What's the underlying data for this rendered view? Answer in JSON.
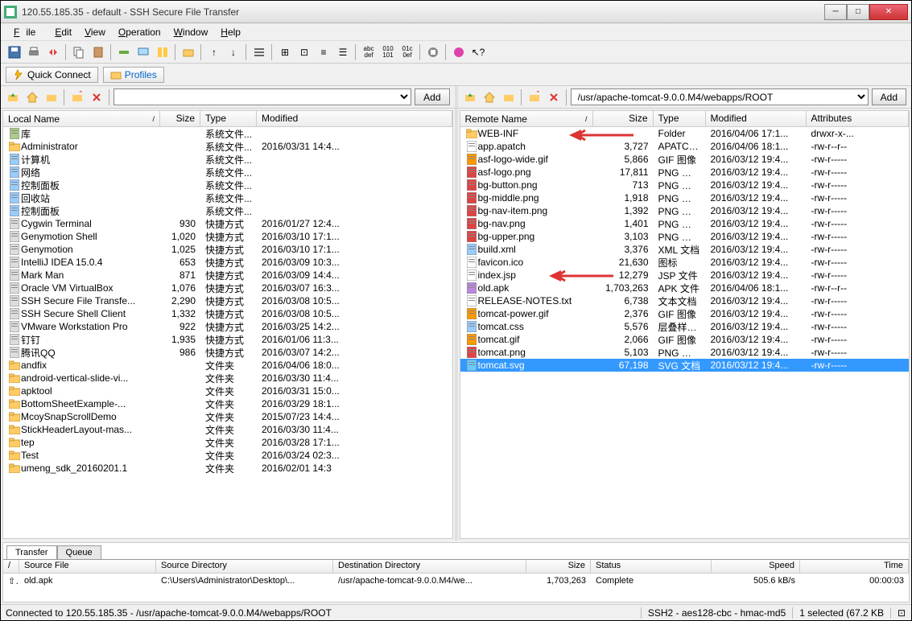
{
  "window": {
    "title": "120.55.185.35 - default - SSH Secure File Transfer"
  },
  "menu": [
    "File",
    "Edit",
    "View",
    "Operation",
    "Window",
    "Help"
  ],
  "quickbar": {
    "connect": "Quick Connect",
    "profiles": "Profiles"
  },
  "pathbar": {
    "local_path": "",
    "remote_path": "/usr/apache-tomcat-9.0.0.M4/webapps/ROOT",
    "add": "Add"
  },
  "local": {
    "headers": {
      "name": "Local Name",
      "size": "Size",
      "type": "Type",
      "modified": "Modified"
    },
    "rows": [
      {
        "icon": "lib",
        "name": "库",
        "size": "",
        "type": "系统文件...",
        "mod": ""
      },
      {
        "icon": "folder",
        "name": "Administrator",
        "size": "",
        "type": "系统文件...",
        "mod": "2016/03/31 14:4..."
      },
      {
        "icon": "computer",
        "name": "计算机",
        "size": "",
        "type": "系统文件...",
        "mod": ""
      },
      {
        "icon": "network",
        "name": "网络",
        "size": "",
        "type": "系统文件...",
        "mod": ""
      },
      {
        "icon": "cpl",
        "name": "控制面板",
        "size": "",
        "type": "系统文件...",
        "mod": ""
      },
      {
        "icon": "recycle",
        "name": "回收站",
        "size": "",
        "type": "系统文件...",
        "mod": ""
      },
      {
        "icon": "cpl",
        "name": "控制面板",
        "size": "",
        "type": "系统文件...",
        "mod": ""
      },
      {
        "icon": "app",
        "name": "Cygwin Terminal",
        "size": "930",
        "type": "快捷方式",
        "mod": "2016/01/27 12:4..."
      },
      {
        "icon": "app",
        "name": "Genymotion Shell",
        "size": "1,020",
        "type": "快捷方式",
        "mod": "2016/03/10 17:1..."
      },
      {
        "icon": "app",
        "name": "Genymotion",
        "size": "1,025",
        "type": "快捷方式",
        "mod": "2016/03/10 17:1..."
      },
      {
        "icon": "app",
        "name": "IntelliJ IDEA 15.0.4",
        "size": "653",
        "type": "快捷方式",
        "mod": "2016/03/09 10:3..."
      },
      {
        "icon": "app",
        "name": "Mark Man",
        "size": "871",
        "type": "快捷方式",
        "mod": "2016/03/09 14:4..."
      },
      {
        "icon": "app",
        "name": "Oracle VM VirtualBox",
        "size": "1,076",
        "type": "快捷方式",
        "mod": "2016/03/07 16:3..."
      },
      {
        "icon": "app",
        "name": "SSH Secure File Transfe...",
        "size": "2,290",
        "type": "快捷方式",
        "mod": "2016/03/08 10:5..."
      },
      {
        "icon": "app",
        "name": "SSH Secure Shell Client",
        "size": "1,332",
        "type": "快捷方式",
        "mod": "2016/03/08 10:5..."
      },
      {
        "icon": "app",
        "name": "VMware Workstation Pro",
        "size": "922",
        "type": "快捷方式",
        "mod": "2016/03/25 14:2..."
      },
      {
        "icon": "app",
        "name": "钉钉",
        "size": "1,935",
        "type": "快捷方式",
        "mod": "2016/01/06 11:3..."
      },
      {
        "icon": "app",
        "name": "腾讯QQ",
        "size": "986",
        "type": "快捷方式",
        "mod": "2016/03/07 14:2..."
      },
      {
        "icon": "folder",
        "name": "andfix",
        "size": "",
        "type": "文件夹",
        "mod": "2016/04/06 18:0..."
      },
      {
        "icon": "folder",
        "name": "android-vertical-slide-vi...",
        "size": "",
        "type": "文件夹",
        "mod": "2016/03/30 11:4..."
      },
      {
        "icon": "folder",
        "name": "apktool",
        "size": "",
        "type": "文件夹",
        "mod": "2016/03/31 15:0..."
      },
      {
        "icon": "folder",
        "name": "BottomSheetExample-...",
        "size": "",
        "type": "文件夹",
        "mod": "2016/03/29 18:1..."
      },
      {
        "icon": "folder",
        "name": "McoySnapScrollDemo",
        "size": "",
        "type": "文件夹",
        "mod": "2015/07/23 14:4..."
      },
      {
        "icon": "folder",
        "name": "StickHeaderLayout-mas...",
        "size": "",
        "type": "文件夹",
        "mod": "2016/03/30 11:4..."
      },
      {
        "icon": "folder",
        "name": "tep",
        "size": "",
        "type": "文件夹",
        "mod": "2016/03/28 17:1..."
      },
      {
        "icon": "folder",
        "name": "Test",
        "size": "",
        "type": "文件夹",
        "mod": "2016/03/24 02:3..."
      },
      {
        "icon": "folder",
        "name": "umeng_sdk_20160201.1",
        "size": "",
        "type": "文件夹",
        "mod": "2016/02/01 14:3"
      }
    ]
  },
  "remote": {
    "headers": {
      "name": "Remote Name",
      "size": "Size",
      "type": "Type",
      "modified": "Modified",
      "attributes": "Attributes"
    },
    "rows": [
      {
        "icon": "folder",
        "name": "WEB-INF",
        "size": "",
        "type": "Folder",
        "mod": "2016/04/06 17:1...",
        "attr": "drwxr-x-..."
      },
      {
        "icon": "file",
        "name": "app.apatch",
        "size": "3,727",
        "type": "APATCH...",
        "mod": "2016/04/06 18:1...",
        "attr": "-rw-r--r--"
      },
      {
        "icon": "gif",
        "name": "asf-logo-wide.gif",
        "size": "5,866",
        "type": "GIF 图像",
        "mod": "2016/03/12 19:4...",
        "attr": "-rw-r-----"
      },
      {
        "icon": "png",
        "name": "asf-logo.png",
        "size": "17,811",
        "type": "PNG 图像",
        "mod": "2016/03/12 19:4...",
        "attr": "-rw-r-----"
      },
      {
        "icon": "png",
        "name": "bg-button.png",
        "size": "713",
        "type": "PNG 图像",
        "mod": "2016/03/12 19:4...",
        "attr": "-rw-r-----"
      },
      {
        "icon": "png",
        "name": "bg-middle.png",
        "size": "1,918",
        "type": "PNG 图像",
        "mod": "2016/03/12 19:4...",
        "attr": "-rw-r-----"
      },
      {
        "icon": "png",
        "name": "bg-nav-item.png",
        "size": "1,392",
        "type": "PNG 图像",
        "mod": "2016/03/12 19:4...",
        "attr": "-rw-r-----"
      },
      {
        "icon": "png",
        "name": "bg-nav.png",
        "size": "1,401",
        "type": "PNG 图像",
        "mod": "2016/03/12 19:4...",
        "attr": "-rw-r-----"
      },
      {
        "icon": "png",
        "name": "bg-upper.png",
        "size": "3,103",
        "type": "PNG 图像",
        "mod": "2016/03/12 19:4...",
        "attr": "-rw-r-----"
      },
      {
        "icon": "xml",
        "name": "build.xml",
        "size": "3,376",
        "type": "XML 文档",
        "mod": "2016/03/12 19:4...",
        "attr": "-rw-r-----"
      },
      {
        "icon": "ico",
        "name": "favicon.ico",
        "size": "21,630",
        "type": "图标",
        "mod": "2016/03/12 19:4...",
        "attr": "-rw-r-----"
      },
      {
        "icon": "jsp",
        "name": "index.jsp",
        "size": "12,279",
        "type": "JSP 文件",
        "mod": "2016/03/12 19:4...",
        "attr": "-rw-r-----"
      },
      {
        "icon": "apk",
        "name": "old.apk",
        "size": "1,703,263",
        "type": "APK 文件",
        "mod": "2016/04/06 18:1...",
        "attr": "-rw-r--r--"
      },
      {
        "icon": "txt",
        "name": "RELEASE-NOTES.txt",
        "size": "6,738",
        "type": "文本文档",
        "mod": "2016/03/12 19:4...",
        "attr": "-rw-r-----"
      },
      {
        "icon": "gif",
        "name": "tomcat-power.gif",
        "size": "2,376",
        "type": "GIF 图像",
        "mod": "2016/03/12 19:4...",
        "attr": "-rw-r-----"
      },
      {
        "icon": "css",
        "name": "tomcat.css",
        "size": "5,576",
        "type": "层叠样式...",
        "mod": "2016/03/12 19:4...",
        "attr": "-rw-r-----"
      },
      {
        "icon": "gif",
        "name": "tomcat.gif",
        "size": "2,066",
        "type": "GIF 图像",
        "mod": "2016/03/12 19:4...",
        "attr": "-rw-r-----"
      },
      {
        "icon": "png",
        "name": "tomcat.png",
        "size": "5,103",
        "type": "PNG 图像",
        "mod": "2016/03/12 19:4...",
        "attr": "-rw-r-----"
      },
      {
        "icon": "svg",
        "name": "tomcat.svg",
        "size": "67,198",
        "type": "SVG 文档",
        "mod": "2016/03/12 19:4...",
        "attr": "-rw-r-----",
        "selected": true
      }
    ]
  },
  "transfer": {
    "tabs": [
      "Transfer",
      "Queue"
    ],
    "headers": {
      "dir": "/",
      "src": "Source File",
      "srcdir": "Source Directory",
      "dstdir": "Destination Directory",
      "size": "Size",
      "status": "Status",
      "speed": "Speed",
      "time": "Time"
    },
    "row": {
      "dir": "⇧",
      "src": "old.apk",
      "srcdir": "C:\\Users\\Administrator\\Desktop\\...",
      "dstdir": "/usr/apache-tomcat-9.0.0.M4/we...",
      "size": "1,703,263",
      "status": "Complete",
      "speed": "505.6 kB/s",
      "time": "00:00:03"
    }
  },
  "status": {
    "msg": "Connected to 120.55.185.35 - /usr/apache-tomcat-9.0.0.M4/webapps/ROOT",
    "crypto": "SSH2 - aes128-cbc - hmac-md5",
    "sel": "1 selected (67.2 KB"
  }
}
